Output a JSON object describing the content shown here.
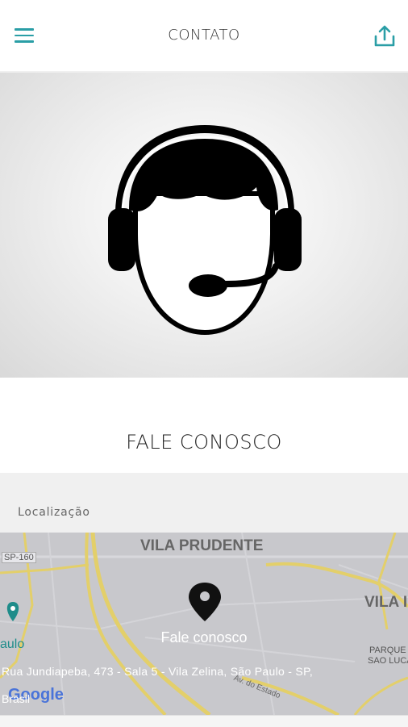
{
  "header": {
    "title": "CONTATO",
    "menu_icon": "hamburger-menu-icon",
    "share_icon": "share-icon",
    "accent_color": "#2a9ea6"
  },
  "hero": {
    "icon": "customer-support-headset-icon"
  },
  "contact": {
    "cta_label": "FALE CONOSCO"
  },
  "location": {
    "section_label": "Localização",
    "map": {
      "district_label": "VILA PRUDENTE",
      "district_label_right": "VILA I",
      "road_label": "SP-160",
      "left_label": "aulo",
      "right_small_label_1": "PARQUE",
      "right_small_label_2": "SAO LUCA",
      "street_label": "Av. do Estado",
      "marker_icon": "map-pin-icon",
      "marker_title": "Fale conosco",
      "address_line1": "Rua Jundiapeba, 473 - Sala 5 - Vila Zelina, São Paulo - SP,",
      "address_line2": "Brasil",
      "attribution": "Google"
    }
  }
}
